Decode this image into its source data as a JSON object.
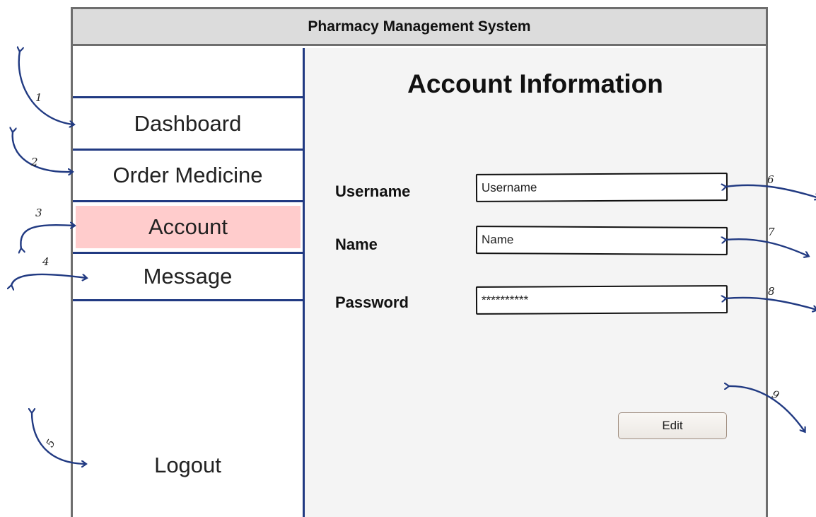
{
  "app": {
    "title": "Pharmacy Management System"
  },
  "sidebar": {
    "items": [
      {
        "label": "Dashboard",
        "active": false
      },
      {
        "label": "Order Medicine",
        "active": false
      },
      {
        "label": "Account",
        "active": true
      },
      {
        "label": "Message",
        "active": false
      }
    ],
    "logout_label": "Logout",
    "active_color": "#ffcccc",
    "divider_color": "#213a82"
  },
  "main": {
    "title": "Account Information",
    "fields": [
      {
        "label": "Username",
        "value": "Username"
      },
      {
        "label": "Name",
        "value": "Name"
      },
      {
        "label": "Password",
        "value": "**********"
      }
    ],
    "edit_label": "Edit"
  },
  "annotations": {
    "numbers": [
      "1",
      "2",
      "3",
      "4",
      "5",
      "6",
      "7",
      "8",
      "9"
    ],
    "color": "#213a82"
  }
}
